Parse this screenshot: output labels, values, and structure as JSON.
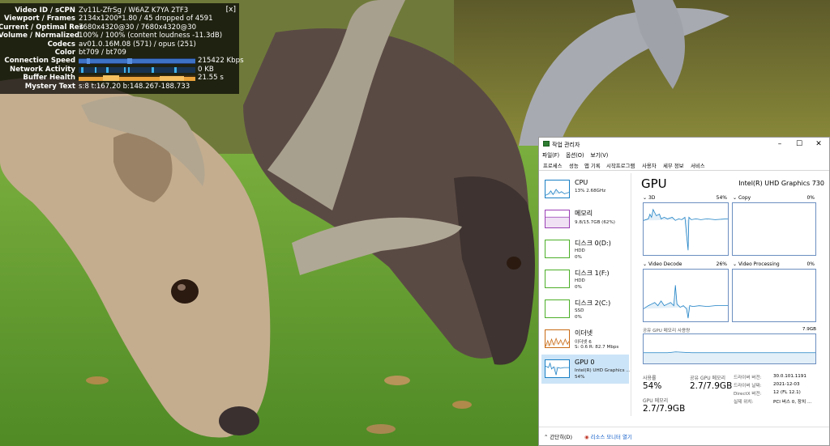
{
  "stats_for_nerds": {
    "close_label": "[x]",
    "rows": [
      {
        "label": "Video ID / sCPN",
        "value": "Zv11L-ZfrSg / W6AZ K7YA 2TF3"
      },
      {
        "label": "Viewport / Frames",
        "value": "2134x1200*1.80 / 45 dropped of 4591"
      },
      {
        "label": "Current / Optimal Res",
        "value": "7680x4320@30 / 7680x4320@30"
      },
      {
        "label": "Volume / Normalized",
        "value": "100% / 100% (content loudness -11.3dB)"
      },
      {
        "label": "Codecs",
        "value": "av01.0.16M.08 (571) / opus (251)"
      },
      {
        "label": "Color",
        "value": "bt709 / bt709"
      },
      {
        "label": "Connection Speed",
        "value": "215422 Kbps"
      },
      {
        "label": "Network Activity",
        "value": "0 KB"
      },
      {
        "label": "Buffer Health",
        "value": "21.55 s"
      },
      {
        "label": "Mystery Text",
        "value": "s:8 t:167.20 b:148.267-188.733"
      }
    ]
  },
  "task_manager": {
    "title": "작업 관리자",
    "menu": [
      "파일(F)",
      "옵션(O)",
      "보기(V)"
    ],
    "tabs": [
      "프로세스",
      "성능",
      "앱 기록",
      "시작프로그램",
      "사용자",
      "세부 정보",
      "서비스"
    ],
    "sidebar": [
      {
        "name": "CPU",
        "sub1": "13% 2.68GHz",
        "sub2": "",
        "color": "#1a7fc4"
      },
      {
        "name": "메모리",
        "sub1": "9.8/15.7GB (62%)",
        "sub2": "",
        "color": "#9b3fb5"
      },
      {
        "name": "디스크 0(D:)",
        "sub1": "HDD",
        "sub2": "0%",
        "color": "#4caf28"
      },
      {
        "name": "디스크 1(F:)",
        "sub1": "HDD",
        "sub2": "0%",
        "color": "#4caf28"
      },
      {
        "name": "디스크 2(C:)",
        "sub1": "SSD",
        "sub2": "0%",
        "color": "#4caf28"
      },
      {
        "name": "이더넷",
        "sub1": "이더넷 6",
        "sub2": "S: 0.6  R: 82.7 Mbps",
        "color": "#c96b16"
      },
      {
        "name": "GPU 0",
        "sub1": "Intel(R) UHD Graphics ...",
        "sub2": "54%",
        "color": "#1a7fc4"
      }
    ],
    "gpu": {
      "title": "GPU",
      "name": "Intel(R) UHD Graphics 730",
      "engines": [
        {
          "label": "3D",
          "pct": "54%"
        },
        {
          "label": "Copy",
          "pct": "0%"
        },
        {
          "label": "Video Decode",
          "pct": "26%"
        },
        {
          "label": "Video Processing",
          "pct": "0%"
        }
      ],
      "shared_mem_label": "공유 GPU 메모리 사용량",
      "shared_mem_max": "7.9GB",
      "utilization_label": "사용률",
      "utilization": "54%",
      "shared_mem_stat_label": "공유 GPU 메모리",
      "shared_mem_stat": "2.7/7.9GB",
      "gpu_mem_label": "GPU 메모리",
      "gpu_mem": "2.7/7.9GB",
      "info": [
        {
          "k": "드라이버 버전:",
          "v": "30.0.101.1191"
        },
        {
          "k": "드라이버 날짜:",
          "v": "2021-12-03"
        },
        {
          "k": "DirectX 버전:",
          "v": "12 (FL 12.1)"
        },
        {
          "k": "실제 위치:",
          "v": "PCI 버스 0, 장치 ..."
        }
      ]
    },
    "footer": {
      "fewer": "간단히(D)",
      "monitor": "리소스 모니터 열기"
    }
  },
  "colors": {
    "accent": "#1a7fc4",
    "graph_border": "#6c8fc0"
  }
}
